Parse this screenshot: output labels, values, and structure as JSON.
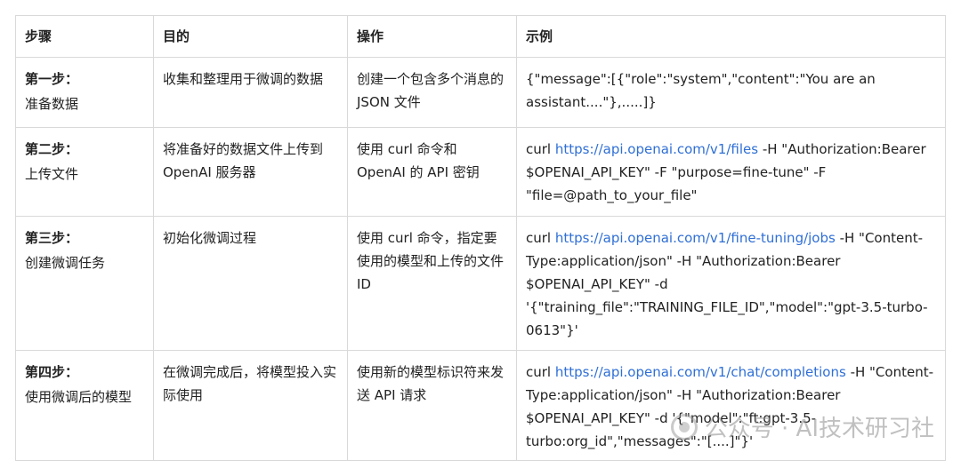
{
  "headers": [
    "步骤",
    "目的",
    "操作",
    "示例"
  ],
  "rows": [
    {
      "step_title": "第一步：",
      "step_name": "准备数据",
      "purpose": "收集和整理用于微调的数据",
      "operation": "创建一个包含多个消息的 JSON 文件",
      "example_pre": "{\"message\":[{\"role\":\"system\",\"content\":\"You are an assistant....\"},.....]}",
      "example_link": "",
      "example_post": ""
    },
    {
      "step_title": "第二步：",
      "step_name": "上传文件",
      "purpose": "将准备好的数据文件上传到 OpenAI 服务器",
      "operation": "使用 curl 命令和 OpenAI 的 API 密钥",
      "example_pre": "curl ",
      "example_link": "https://api.openai.com/v1/files",
      "example_post": " -H \"Authorization:Bearer $OPENAI_API_KEY\" -F \"purpose=fine-tune\" -F \"file=@path_to_your_file\""
    },
    {
      "step_title": "第三步：",
      "step_name": "创建微调任务",
      "purpose": "初始化微调过程",
      "operation": "使用 curl 命令，指定要使用的模型和上传的文件 ID",
      "example_pre": "curl ",
      "example_link": "https://api.openai.com/v1/fine-tuning/jobs",
      "example_post": " -H \"Content-Type:application/json\" -H \"Authorization:Bearer $OPENAI_API_KEY\"  -d '{\"training_file\":\"TRAINING_FILE_ID\",\"model\":\"gpt-3.5-turbo-0613\"}'"
    },
    {
      "step_title": "第四步：",
      "step_name": "使用微调后的模型",
      "purpose": "在微调完成后，将模型投入实际使用",
      "operation": "使用新的模型标识符来发送 API 请求",
      "example_pre": "curl ",
      "example_link": "https://api.openai.com/v1/chat/completions",
      "example_post": " -H \"Content-Type:application/json\" -H \"Authorization:Bearer $OPENAI_API_KEY\"  -d '{\"model\":\"ft:gpt-3.5-turbo:org_id\",\"messages\":\"[....]\"}'"
    }
  ],
  "watermark": {
    "text": "公众号 · AI技术研习社",
    "icon": "wechat-official-account-icon"
  },
  "colors": {
    "link": "#2f6fd6",
    "border": "#d9d9d9",
    "text": "#222222"
  }
}
